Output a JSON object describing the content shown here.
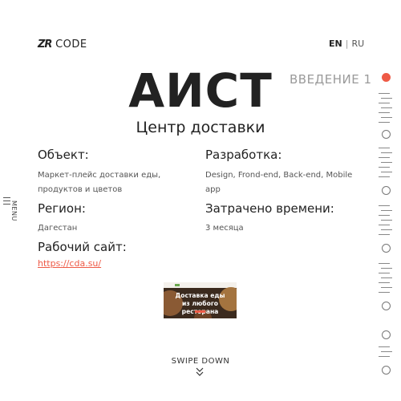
{
  "header": {
    "logo_mark": "ZR",
    "logo_text": "CODE",
    "lang_active": "EN",
    "lang_separator": "|",
    "lang_other": "RU"
  },
  "project": {
    "title": "АИСТ",
    "section_label": "ВВЕДЕНИЕ 1",
    "subtitle": "Центр доставки",
    "object_label": "Объект:",
    "object_value_line1": "Маркет-плейс доставки еды,",
    "object_value_line2": "продуктов и цветов",
    "dev_label": "Разработка:",
    "dev_value_line1": "Design, Frond-end, Back-end, Mobile",
    "dev_value_line2": "app",
    "region_label": "Регион:",
    "region_value": "Дагестан",
    "time_label": "Затрачено времени:",
    "time_value": "3 месяца",
    "site_label": "Рабочий сайт:",
    "site_link": "https://cda.su/"
  },
  "banner": {
    "line1": "Доставка еды",
    "line2": "из любого ресторана"
  },
  "menu": {
    "label": "MENU"
  },
  "footer": {
    "swipe_label": "SWIPE DOWN"
  },
  "colors": {
    "accent": "#ee5a46",
    "text": "#222222",
    "muted": "#9a9a9a"
  },
  "icons": {
    "menu": "hamburger-icon",
    "swipe": "double-chevron-down-icon"
  },
  "section_nav": {
    "count": 9,
    "active_index": 0
  }
}
